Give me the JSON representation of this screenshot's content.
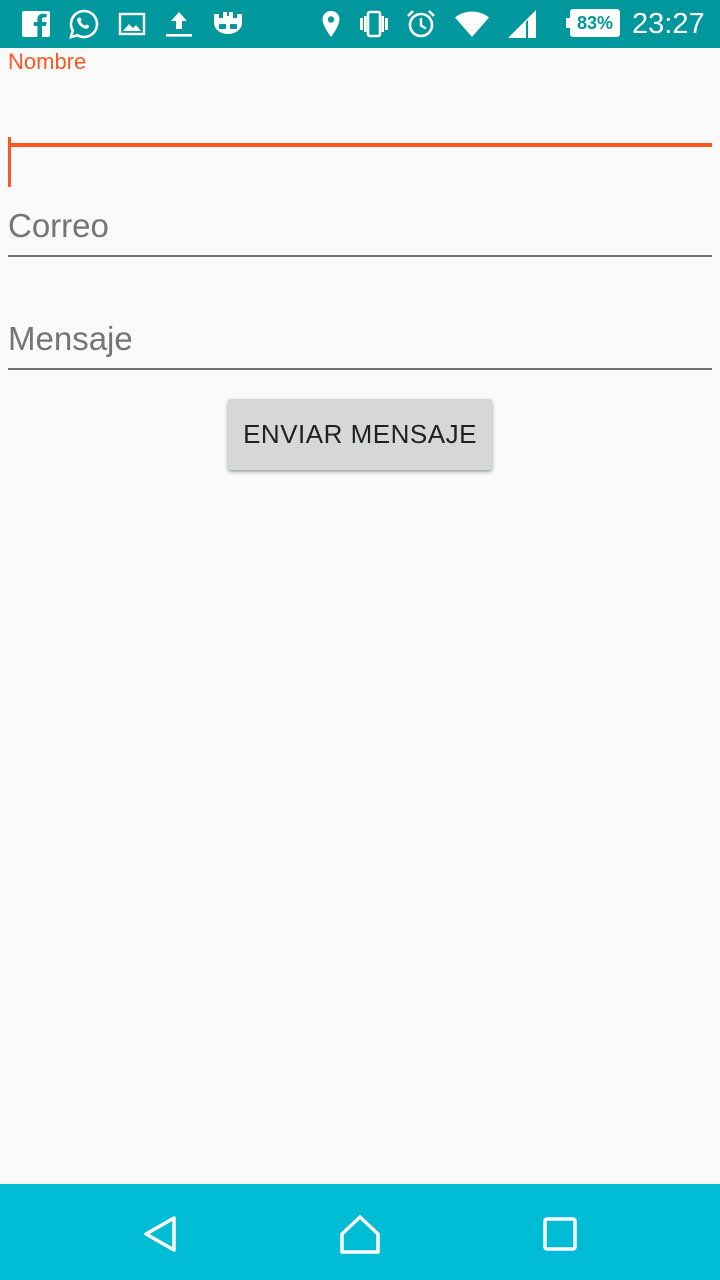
{
  "status_bar": {
    "icons_left": [
      "facebook-icon",
      "whatsapp-icon",
      "image-icon",
      "upload-icon",
      "castle-app-icon"
    ],
    "icons_right": [
      "location-icon",
      "vibrate-icon",
      "alarm-icon",
      "wifi-icon",
      "signal-icon"
    ],
    "battery": "83%",
    "time": "23:27",
    "background_color": "#00979d"
  },
  "form": {
    "nombre": {
      "label": "Nombre",
      "value": ""
    },
    "correo": {
      "placeholder": "Correo",
      "value": ""
    },
    "mensaje": {
      "placeholder": "Mensaje",
      "value": ""
    },
    "accent_color": "#ff5722"
  },
  "send_button": {
    "label": "ENVIAR MENSAJE"
  },
  "nav_bar": {
    "buttons": [
      "back-icon",
      "home-icon",
      "recents-icon"
    ],
    "background_color": "#00bcd4"
  }
}
